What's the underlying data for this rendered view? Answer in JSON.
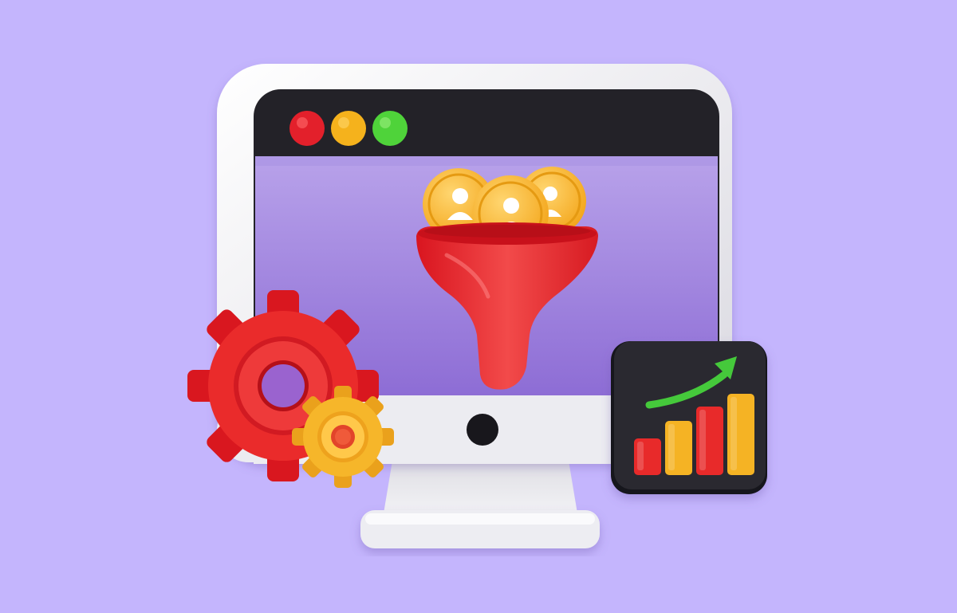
{
  "scene": {
    "background_color": "#c4b5fd",
    "subject": "3d-illustration",
    "elements": [
      "monitor-icon",
      "window-controls",
      "sales-funnel-icon",
      "user-coin-icon",
      "gear-icon",
      "growth-chart-icon"
    ]
  },
  "monitor": {
    "frame_color": "#ececf1",
    "title_bar_color": "#232228",
    "screen_color": "#9b80dc",
    "window_controls": [
      {
        "name": "close",
        "color": "#e3202b"
      },
      {
        "name": "minimize",
        "color": "#f5b21c"
      },
      {
        "name": "maximize",
        "color": "#4fd33a"
      }
    ]
  },
  "funnel": {
    "color": "#e9262f",
    "coins": 3,
    "coin_color": "#f8b427"
  },
  "gears": [
    {
      "size": "large",
      "color": "#ea2b2b"
    },
    {
      "size": "small",
      "color": "#f6b62a"
    }
  ],
  "growth_card": {
    "card_color": "#242329",
    "arrow_color": "#45c93b",
    "bar_levels": [
      0.45,
      0.67,
      0.84,
      1.0
    ],
    "bar_colors": [
      "#e82a2a",
      "#f5b324",
      "#e82a2a",
      "#f5b324"
    ]
  }
}
